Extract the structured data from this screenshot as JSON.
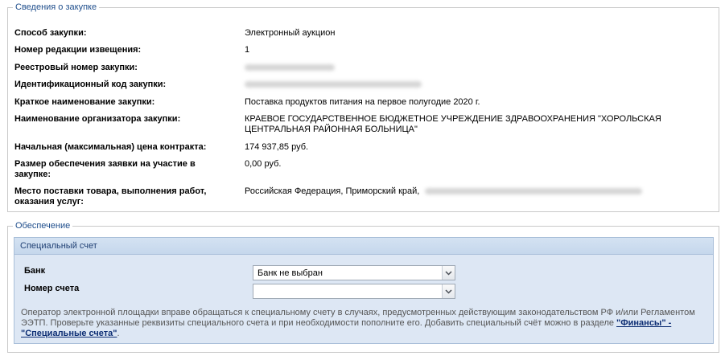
{
  "procurement": {
    "legend": "Сведения о закупке",
    "rows": [
      {
        "label": "Способ закупки:",
        "value": "Электронный аукцион"
      },
      {
        "label": "Номер редакции извещения:",
        "value": "1"
      },
      {
        "label": "Реестровый номер закупки:",
        "value": ""
      },
      {
        "label": "Идентификационный код закупки:",
        "value": ""
      },
      {
        "label": "Краткое наименование закупки:",
        "value": "Поставка продуктов питания на первое полугодие 2020 г."
      },
      {
        "label": "Наименование организатора закупки:",
        "value": "КРАЕВОЕ ГОСУДАРСТВЕННОЕ БЮДЖЕТНОЕ УЧРЕЖДЕНИЕ ЗДРАВООХРАНЕНИЯ \"ХОРОЛЬСКАЯ ЦЕНТРАЛЬНАЯ РАЙОННАЯ БОЛЬНИЦА\""
      },
      {
        "label": "Начальная (максимальная) цена контракта:",
        "value": "174 937,85 руб."
      },
      {
        "label": "Размер обеспечения заявки на участие в закупке:",
        "value": "0,00 руб."
      },
      {
        "label": "Место поставки товара, выполнения работ, оказания услуг:",
        "value": "Российская Федерация, Приморский край,"
      }
    ]
  },
  "security": {
    "legend": "Обеспечение",
    "panel_title": "Специальный счет",
    "bank_label": "Банк",
    "bank_value": "Банк не выбран",
    "account_label": "Номер счета",
    "account_value": "",
    "note_text": "Оператор электронной площадки вправе обращаться к специальному счету в случаях, предусмотренных действующим законодательством РФ и/или Регламентом ЭЭТП. Проверьте указанные реквизиты специального счета и при необходимости пополните его. Добавить специальный счёт можно в разделе ",
    "note_link": "\"Финансы\" - \"Специальные счета\"",
    "note_end": "."
  },
  "icons": {
    "dropdown": "chevron-down-icon"
  },
  "colors": {
    "legend": "#1f4e8c",
    "panel_bg": "#dde7f4",
    "panel_border": "#a9bfd9",
    "link": "#0c2d73"
  }
}
